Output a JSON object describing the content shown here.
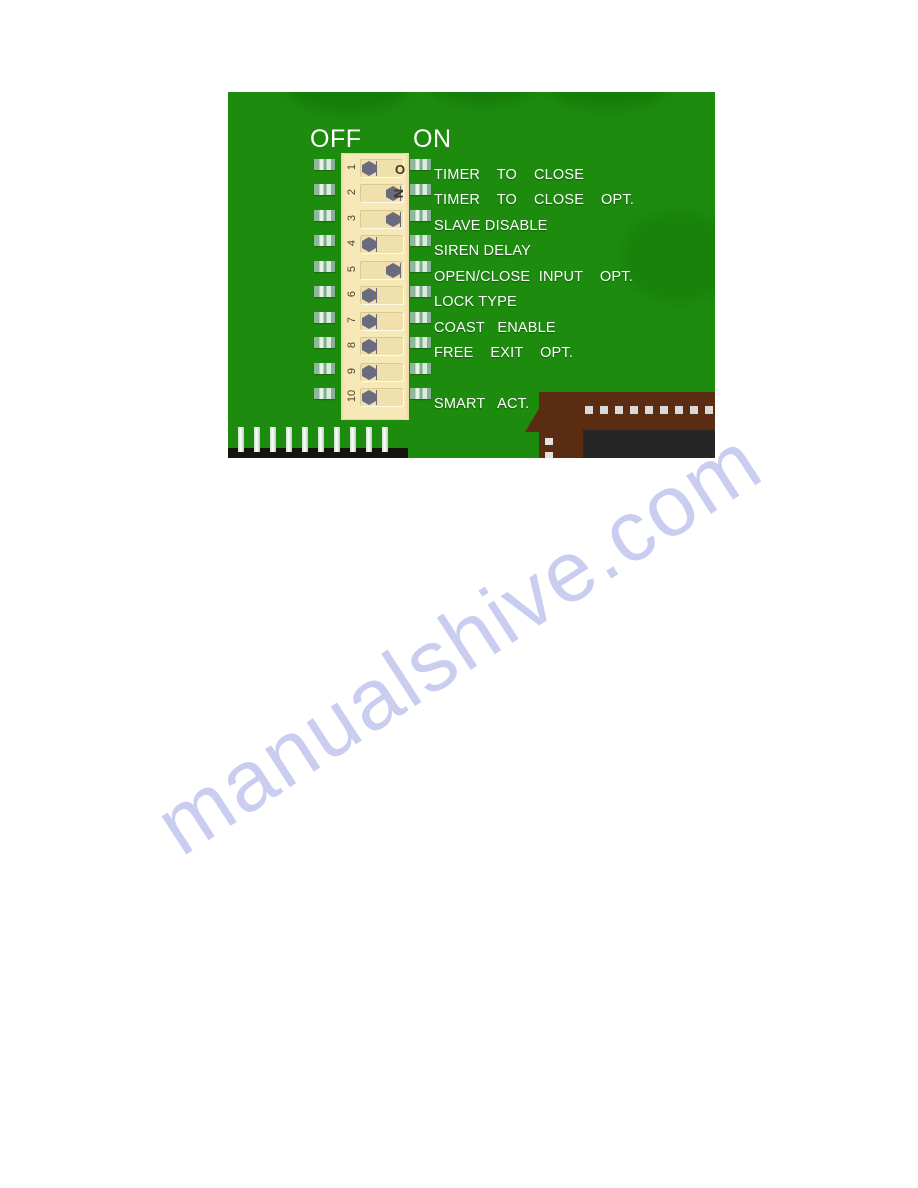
{
  "document": {
    "background_color": "#ffffff",
    "watermark_text": "manualshive.com",
    "watermark_color": "#c9cdf0"
  },
  "figure": {
    "caption": "",
    "board_color": "#1c8b0e",
    "dip_body_color": "#f7e9b7",
    "toggle_color": "#6b6b80",
    "label_color": "#ffffff",
    "connector_color": "#5a2d12",
    "headers": {
      "off": "OFF",
      "on": "ON"
    },
    "direction_letters": {
      "o": "O",
      "n": "N"
    },
    "dip_switch": {
      "positions": 10,
      "switches": [
        {
          "number": "1",
          "state": "off",
          "function": "TIMER    TO    CLOSE"
        },
        {
          "number": "2",
          "state": "on",
          "function": "TIMER    TO    CLOSE    OPT."
        },
        {
          "number": "3",
          "state": "on",
          "function": "SLAVE DISABLE"
        },
        {
          "number": "4",
          "state": "off",
          "function": "SIREN DELAY"
        },
        {
          "number": "5",
          "state": "on",
          "function": "OPEN/CLOSE  INPUT    OPT."
        },
        {
          "number": "6",
          "state": "off",
          "function": "LOCK TYPE"
        },
        {
          "number": "7",
          "state": "off",
          "function": "COAST   ENABLE"
        },
        {
          "number": "8",
          "state": "off",
          "function": "FREE    EXIT    OPT."
        },
        {
          "number": "9",
          "state": "off",
          "function": ""
        },
        {
          "number": "10",
          "state": "off",
          "function": "SMART   ACT."
        }
      ]
    },
    "pin_header": {
      "pin_count": 10
    },
    "brown_connector": {
      "pad_count": 11
    }
  }
}
